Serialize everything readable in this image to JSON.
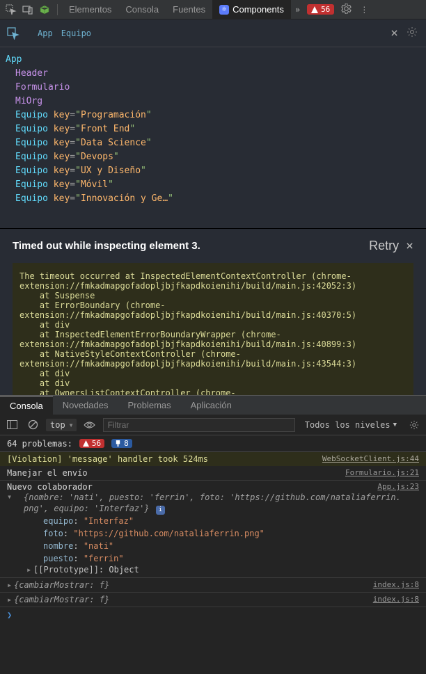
{
  "main_tabs": {
    "elementos": "Elementos",
    "consola": "Consola",
    "fuentes": "Fuentes",
    "components": "Components"
  },
  "error_count": "56",
  "breadcrumb": {
    "app": "App",
    "equipo": "Equipo"
  },
  "tree": {
    "root": "App",
    "header": "Header",
    "formulario": "Formulario",
    "miorg": "MiOrg",
    "equipo": "Equipo",
    "key_label": "key",
    "keys": [
      "Programación",
      "Front End",
      "Data Science",
      "Devops",
      "UX y Diseño",
      "Móvil",
      "Innovación y Ge…"
    ]
  },
  "error": {
    "title": "Timed out while inspecting element 3.",
    "retry": "Retry",
    "stack": "The timeout occurred at InspectedElementContextController (chrome-\nextension://fmkadmapgofadopljbjfkapdkoienihi/build/main.js:42052:3)\n    at Suspense\n    at ErrorBoundary (chrome-\nextension://fmkadmapgofadopljbjfkapdkoienihi/build/main.js:40370:5)\n    at div\n    at InspectedElementErrorBoundaryWrapper (chrome-\nextension://fmkadmapgofadopljbjfkapdkoienihi/build/main.js:40899:3)\n    at NativeStyleContextController (chrome-\nextension://fmkadmapgofadopljbjfkapdkoienihi/build/main.js:43544:3)\n    at div\n    at div\n    at OwnersListContextController (chrome-"
  },
  "console_tabs": {
    "consola": "Consola",
    "novedades": "Novedades",
    "problemas": "Problemas",
    "aplicacion": "Aplicación"
  },
  "console_toolbar": {
    "top": "top",
    "filter_placeholder": "Filtrar",
    "levels": "Todos los niveles"
  },
  "problems": {
    "label": "64 problemas:",
    "errors": "56",
    "info": "8"
  },
  "violation": {
    "msg_prefix": "[Violation]",
    "msg_body": " 'message' handler took 524ms",
    "link": "WebSocketClient.js:44"
  },
  "manejar": {
    "msg": "Manejar el envío",
    "link": "Formulario.js:21"
  },
  "nuevo": {
    "head": "Nuevo colaborador",
    "link": "App.js:23",
    "obj_line1": "{nombre: 'nati', puesto: 'ferrin', foto: 'https://github.com/nataliaferrin.",
    "obj_line2": "png', equipo: 'Interfaz'}",
    "props": {
      "equipo_k": "equipo",
      "equipo_v": "\"Interfaz\"",
      "foto_k": "foto",
      "foto_v": "\"https://github.com/nataliaferrin.png\"",
      "nombre_k": "nombre",
      "nombre_v": "\"nati\"",
      "puesto_k": "puesto",
      "puesto_v": "\"ferrin\""
    },
    "proto_label": "[[Prototype]]",
    "proto_val": ": Object"
  },
  "fns": {
    "obj": "{cambiarMostrar: f}",
    "link": "index.js:8"
  }
}
